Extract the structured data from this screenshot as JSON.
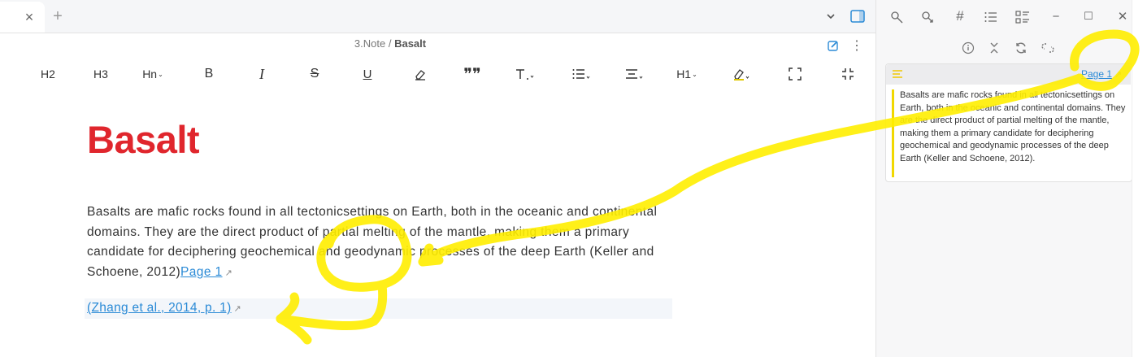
{
  "window": {
    "minimize": "−",
    "maximize": "☐",
    "close": "✕"
  },
  "tabs": {
    "close_glyph": "×",
    "new_glyph": "+"
  },
  "header": {
    "folder": "3.Note",
    "separator": "/",
    "title": "Basalt"
  },
  "toolbar": {
    "items": [
      {
        "label": "H2",
        "icon": "heading-2-icon"
      },
      {
        "label": "H3",
        "icon": "heading-3-icon"
      },
      {
        "label": "Hn",
        "icon": "heading-n-icon"
      },
      {
        "label": "B",
        "icon": "bold-icon"
      },
      {
        "label": "I",
        "icon": "italic-icon"
      },
      {
        "label": "S",
        "icon": "strikethrough-icon"
      },
      {
        "label": "U",
        "icon": "underline-icon"
      },
      {
        "label": "",
        "icon": "eraser-icon"
      },
      {
        "label": "",
        "icon": "quote-icon"
      },
      {
        "label": "",
        "icon": "text-size-icon"
      },
      {
        "label": "",
        "icon": "list-icon"
      },
      {
        "label": "",
        "icon": "align-icon"
      },
      {
        "label": "H1",
        "icon": "heading-1-icon"
      },
      {
        "label": "",
        "icon": "highlight-icon"
      },
      {
        "label": "",
        "icon": "fullscreen-icon"
      },
      {
        "label": "",
        "icon": "exit-fullscreen-icon"
      }
    ]
  },
  "note": {
    "title": "Basalt",
    "paragraph": "Basalts are mafic rocks found in all tectonicsettings on Earth, both in the oceanic and continental domains. They are the direct product of partial melting of the mantle, making them a primary candidate for deciphering geochemical and geodynamic processes of the deep Earth (Keller and Schoene, 2012)",
    "page_link": "Page 1",
    "citation": "(Zhang et al., 2014, p. 1)"
  },
  "side_panel": {
    "card_link": "Page 1",
    "card_text": "Basalts are mafic rocks found in all tectonicsettings on Earth, both in the oceanic and continental domains. They are the direct product of partial melting of the mantle, making them a primary candidate for deciphering geochemical and geodynamic processes of the deep Earth (Keller and Schoene, 2012)."
  },
  "colors": {
    "title": "#e0262d",
    "link": "#2a8ad6",
    "highlight_bar": "#f1d800",
    "annotation": "#ffee00"
  }
}
